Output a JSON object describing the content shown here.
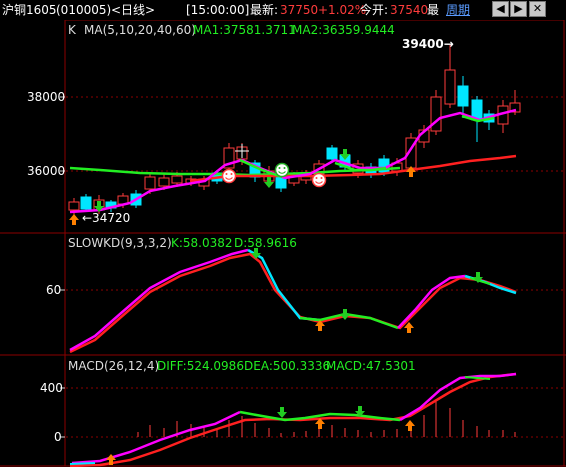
{
  "header": {
    "title": "沪铜1605",
    "code": "(010005)",
    "period": "<日线>",
    "time": "[15:00:00]",
    "latest_label": "最新:",
    "latest_value": "37750",
    "change": "+1.02%",
    "open_label": "今开:",
    "open_value": "37540",
    "high_label": "最",
    "period_link": "周期"
  },
  "window_controls": [
    "prev-icon",
    "next-icon",
    "close-icon"
  ],
  "panels": {
    "price": {
      "indicator": "K",
      "ma_params": "MA(5,10,20,40,60)",
      "ma1": "MA1:37581.3711",
      "ma2": "MA2:36359.9444",
      "y_ticks": [
        "38000",
        "36000"
      ],
      "high_annotation": "39400→",
      "low_annotation": "←34720"
    },
    "kd": {
      "name": "SLOWKD(9,3,3,2)",
      "k": "K:58.0382",
      "d": "D:58.9616",
      "y_ticks": [
        "60"
      ]
    },
    "macd": {
      "name": "MACD(26,12,4)",
      "diff": "DIFF:524.0986",
      "dea": "DEA:500.3336",
      "macd": "MACD:47.5301",
      "y_ticks": [
        "400",
        "0"
      ]
    }
  },
  "colors": {
    "up": "#ff3c3c",
    "down": "#00e6ff",
    "ma1": "#ff00ff",
    "ma2": "#ff2020",
    "ma_other": "#22ee22",
    "grid": "#8b0000",
    "axis_text": "#ffffff",
    "k_line": "#00e6ff",
    "d_line": "#ff2020",
    "diff_line": "#ff00ff",
    "dea_line": "#ff2020"
  }
}
